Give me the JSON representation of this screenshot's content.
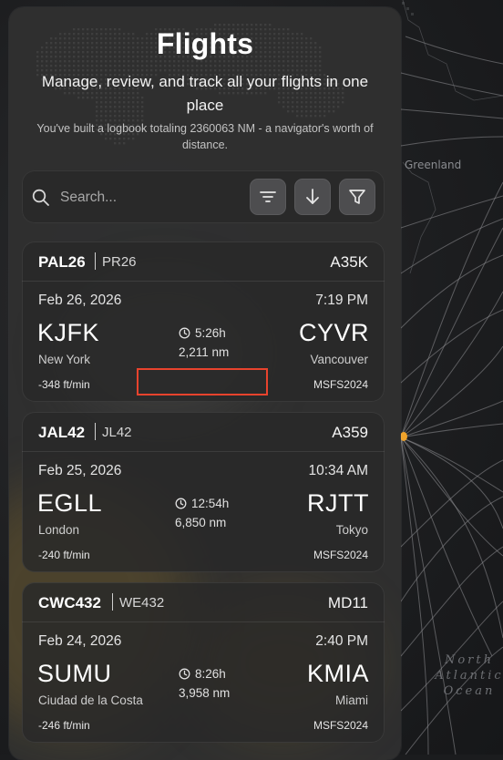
{
  "header": {
    "title": "Flights",
    "subtitle": "Manage, review, and track all your flights in one place",
    "stats": "You've built a logbook totaling 2360063 NM - a navigator's worth of distance."
  },
  "toolbar": {
    "search_placeholder": "Search...",
    "buttons": [
      {
        "name": "sort-options",
        "icon": "sort-lines-icon"
      },
      {
        "name": "sort-direction",
        "icon": "arrow-down-icon"
      },
      {
        "name": "filter",
        "icon": "filter-funnel-icon"
      }
    ]
  },
  "flights": [
    {
      "flight_no": "PAL26",
      "callsign": "PR26",
      "aircraft": "A35K",
      "date": "Feb 26, 2026",
      "time": "7:19 PM",
      "dep_code": "KJFK",
      "dep_city": "New York",
      "arr_code": "CYVR",
      "arr_city": "Vancouver",
      "duration": "5:26h",
      "distance": "2,211 nm",
      "vertical_speed": "-348 ft/min",
      "sim": "MSFS2024"
    },
    {
      "flight_no": "JAL42",
      "callsign": "JL42",
      "aircraft": "A359",
      "date": "Feb 25, 2026",
      "time": "10:34 AM",
      "dep_code": "EGLL",
      "dep_city": "London",
      "arr_code": "RJTT",
      "arr_city": "Tokyo",
      "duration": "12:54h",
      "distance": "6,850 nm",
      "vertical_speed": "-240 ft/min",
      "sim": "MSFS2024"
    },
    {
      "flight_no": "CWC432",
      "callsign": "WE432",
      "aircraft": "MD11",
      "date": "Feb 24, 2026",
      "time": "2:40 PM",
      "dep_code": "SUMU",
      "dep_city": "Ciudad de la Costa",
      "arr_code": "KMIA",
      "arr_city": "Miami",
      "duration": "8:26h",
      "distance": "3,958 nm",
      "vertical_speed": "-246 ft/min",
      "sim": "MSFS2024"
    }
  ],
  "map": {
    "labels": {
      "greenland": "Greenland",
      "ocean": "North Atlantic Ocean"
    },
    "colors": {
      "routes": "#9a9b9e",
      "airport_marker": "#f0a32a",
      "highlight": "#e8432d"
    }
  }
}
